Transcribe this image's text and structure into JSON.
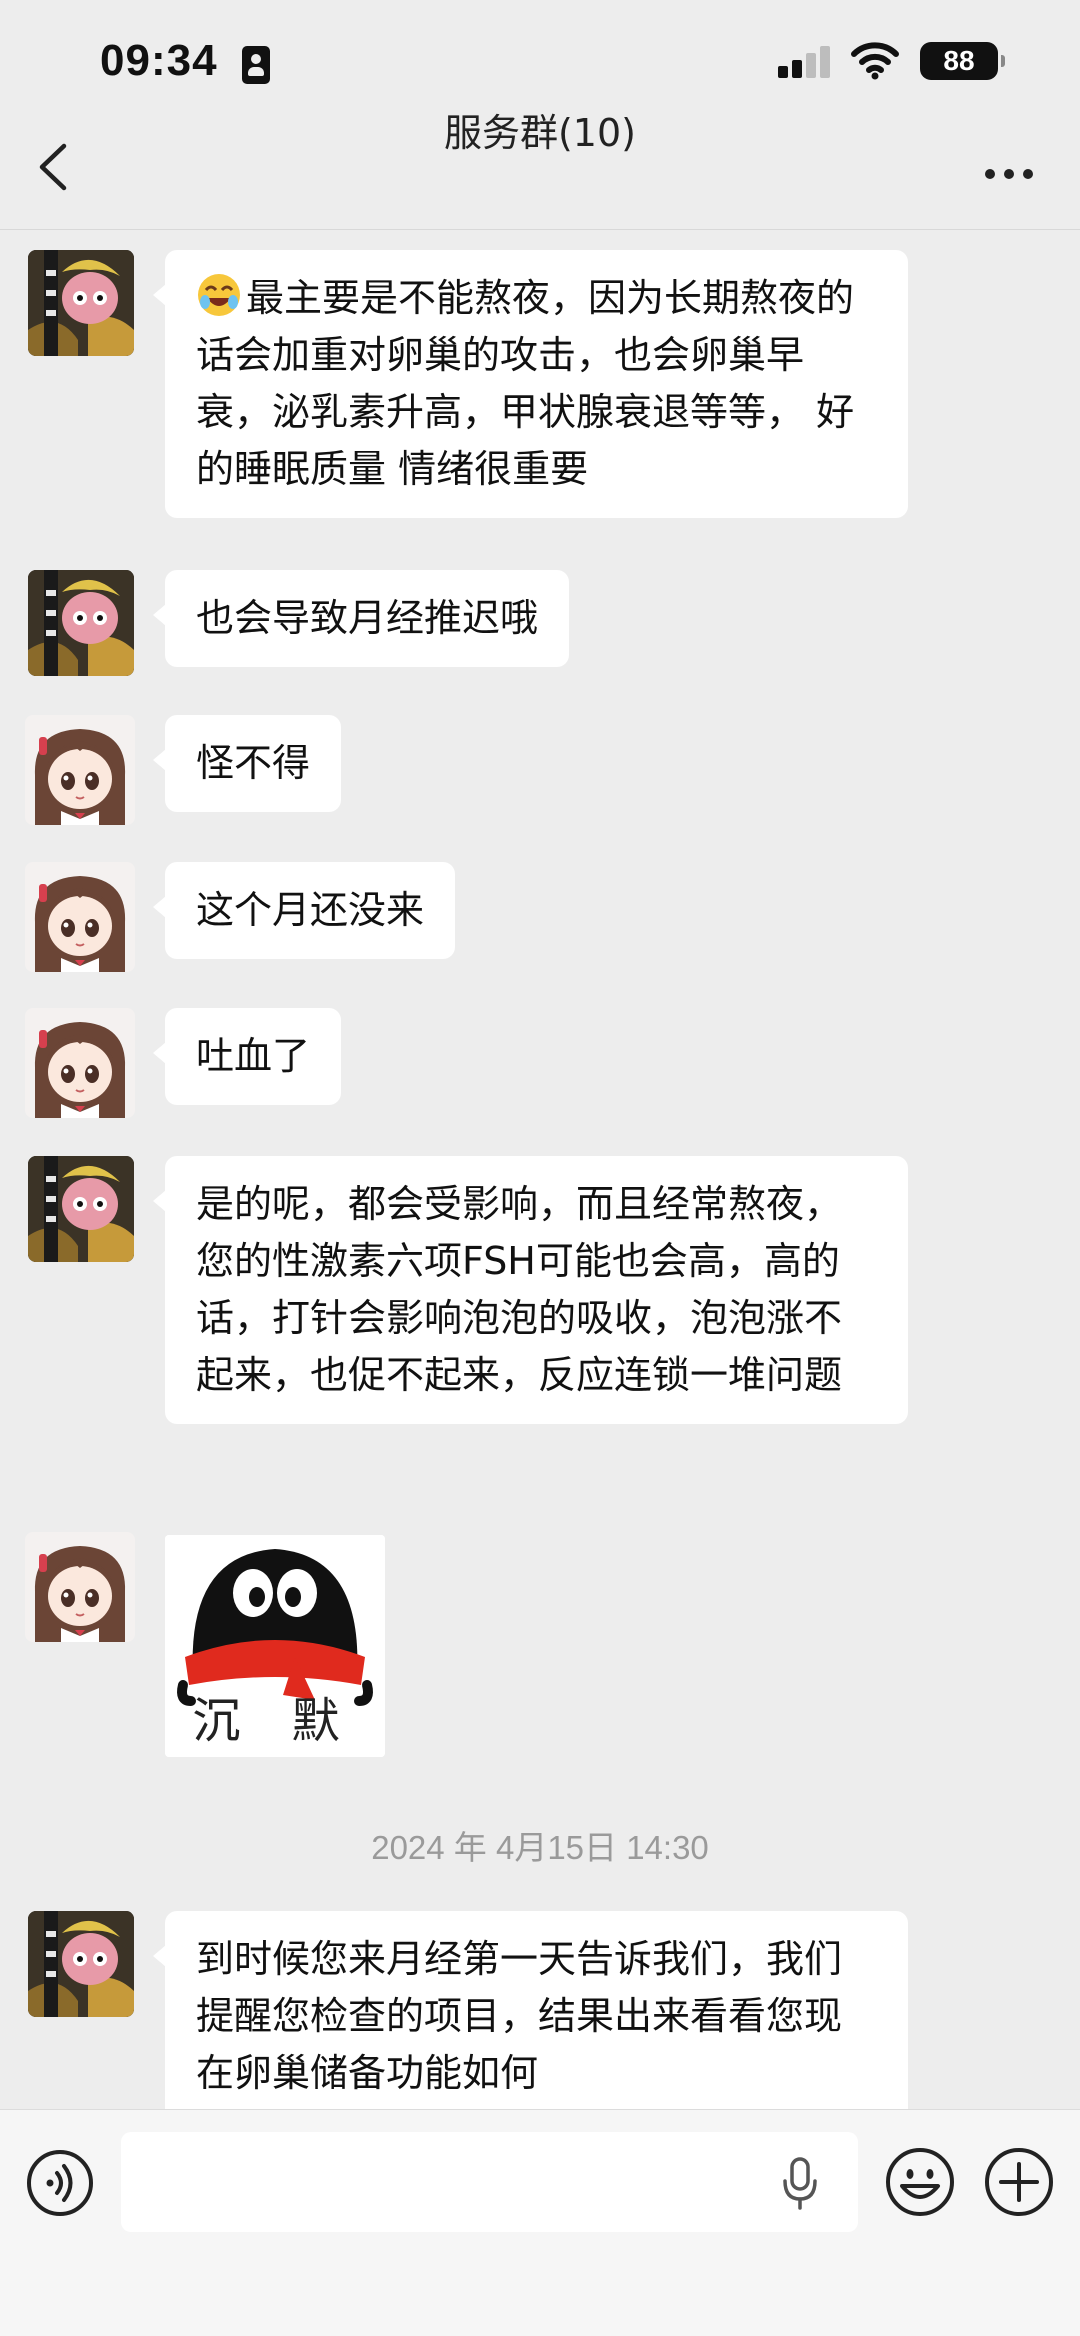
{
  "status_bar": {
    "time": "09:34",
    "battery": "88",
    "icons": [
      "id-card-icon",
      "cellular-signal-icon",
      "wifi-icon",
      "battery-icon"
    ]
  },
  "nav": {
    "title": "服务群(10)",
    "back_icon": "chevron-left-icon",
    "more_icon": "ellipsis-icon"
  },
  "messages": [
    {
      "sender": "staff",
      "type": "text",
      "emoji": "laughing-face-emoji",
      "text": "最主要是不能熬夜，因为长期熬夜的话会加重对卵巢的攻击，也会卵巢早衰，泌乳素升高，甲状腺衰退等等， 好的睡眠质量 情绪很重要"
    },
    {
      "sender": "staff",
      "type": "text",
      "text": "也会导致月经推迟哦"
    },
    {
      "sender": "user",
      "type": "text",
      "text": "怪不得"
    },
    {
      "sender": "user",
      "type": "text",
      "text": "这个月还没来"
    },
    {
      "sender": "user",
      "type": "text",
      "text": "吐血了"
    },
    {
      "sender": "staff",
      "type": "text",
      "text": "是的呢，都会受影响，而且经常熬夜，您的性激素六项FSH可能也会高，高的话，打针会影响泡泡的吸收，泡泡涨不起来，也促不起来，反应连锁一堆问题"
    },
    {
      "sender": "user",
      "type": "sticker",
      "text": "沉 默"
    },
    {
      "sender": "system",
      "type": "timestamp",
      "text": "2024 年 4月15日 14:30"
    },
    {
      "sender": "staff",
      "type": "text",
      "text": "到时候您来月经第一天告诉我们，我们提醒您检查的项目，结果出来看看您现在卵巢储备功能如何"
    }
  ],
  "input_bar": {
    "voice_icon": "voice-mode-icon",
    "input_placeholder": "",
    "mic_icon": "microphone-icon",
    "emoji_icon": "smiley-icon",
    "plus_icon": "plus-circle-icon"
  },
  "colors": {
    "background": "#ededed",
    "bubble": "#ffffff",
    "timestamp": "#9a9a9a"
  }
}
